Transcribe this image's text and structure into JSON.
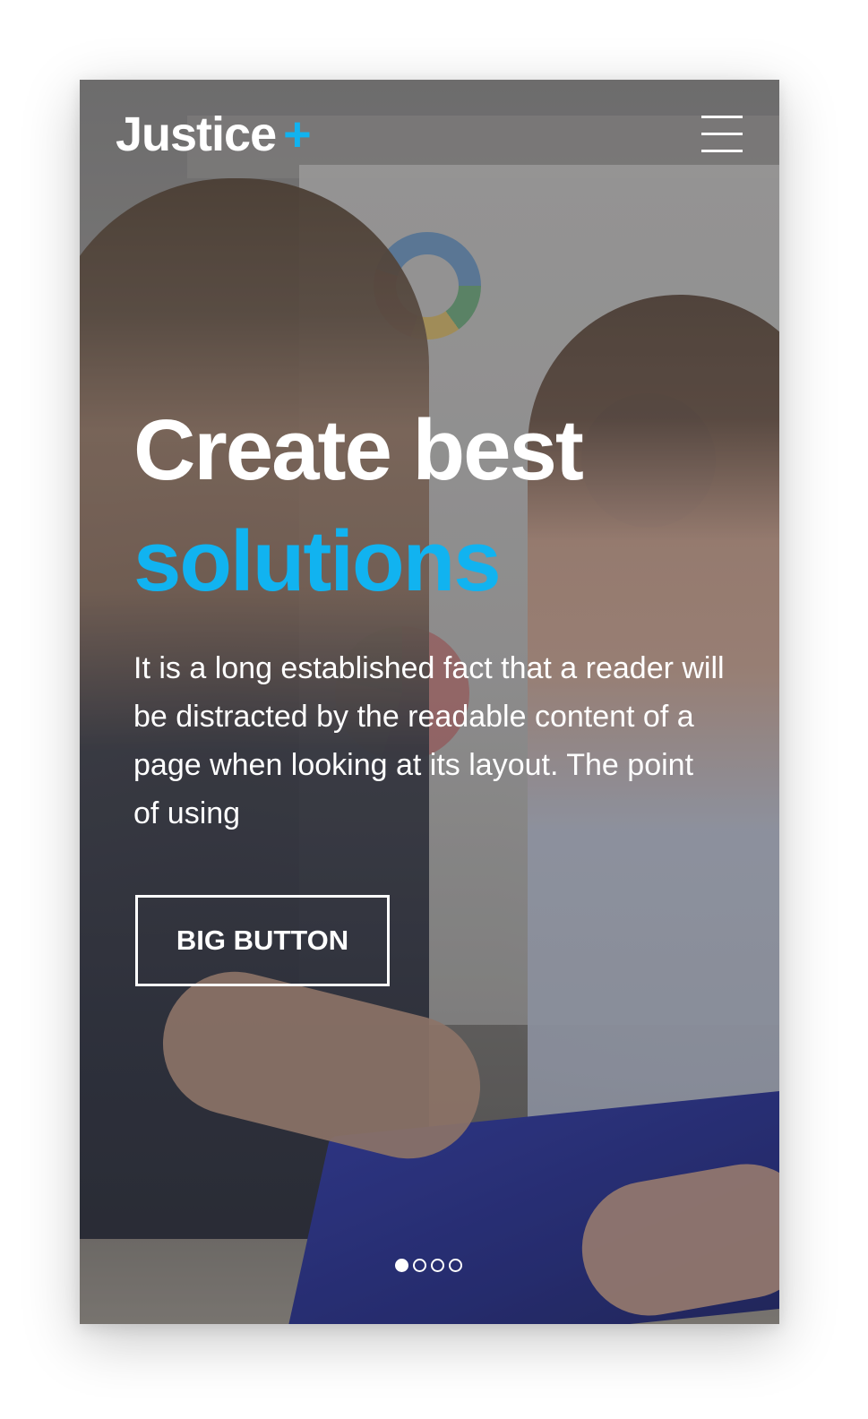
{
  "header": {
    "brand_name": "Justice",
    "brand_mark": "+",
    "menu_icon": "hamburger-menu-icon"
  },
  "hero": {
    "headline_line1": "Create best",
    "headline_line2": "solutions",
    "lead": "It is a long established fact that a reader will be distracted by the readable content of a page when looking at its layout. The point of using",
    "button_label": "BIG BUTTON"
  },
  "carousel": {
    "slide_count": 4,
    "active_slide": 1
  },
  "colors": {
    "accent": "#11b3f0",
    "text": "#ffffff"
  }
}
